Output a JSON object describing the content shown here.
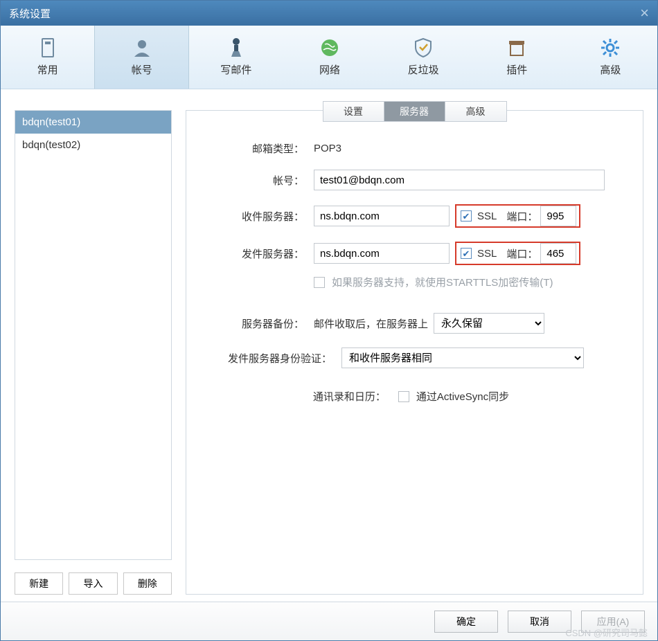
{
  "window": {
    "title": "系统设置"
  },
  "toolbar": {
    "items": [
      {
        "label": "常用"
      },
      {
        "label": "帐号"
      },
      {
        "label": "写邮件"
      },
      {
        "label": "网络"
      },
      {
        "label": "反垃圾"
      },
      {
        "label": "插件"
      },
      {
        "label": "高级"
      }
    ]
  },
  "accounts": {
    "items": [
      {
        "label": "bdqn(test01)"
      },
      {
        "label": "bdqn(test02)"
      }
    ],
    "new_btn": "新建",
    "import_btn": "导入",
    "delete_btn": "删除"
  },
  "subtabs": {
    "settings": "设置",
    "server": "服务器",
    "advanced": "高级"
  },
  "form": {
    "mailbox_type_label": "邮箱类型：",
    "mailbox_type_value": "POP3",
    "account_label": "帐号：",
    "account_value": "test01@bdqn.com",
    "incoming_label": "收件服务器：",
    "incoming_value": "ns.bdqn.com",
    "ssl_label": "SSL",
    "port_label": "端口：",
    "incoming_port": "995",
    "outgoing_label": "发件服务器：",
    "outgoing_value": "ns.bdqn.com",
    "outgoing_port": "465",
    "starttls_label": "如果服务器支持，就使用STARTTLS加密传输(T)",
    "backup_label": "服务器备份：",
    "backup_text": "邮件收取后，在服务器上",
    "backup_select": "永久保留",
    "auth_label": "发件服务器身份验证：",
    "auth_select": "和收件服务器相同",
    "sync_label": "通讯录和日历：",
    "sync_text": "通过ActiveSync同步"
  },
  "footer": {
    "ok": "确定",
    "cancel": "取消",
    "apply": "应用(A)"
  },
  "watermark": "CSDN @研究司马懿"
}
